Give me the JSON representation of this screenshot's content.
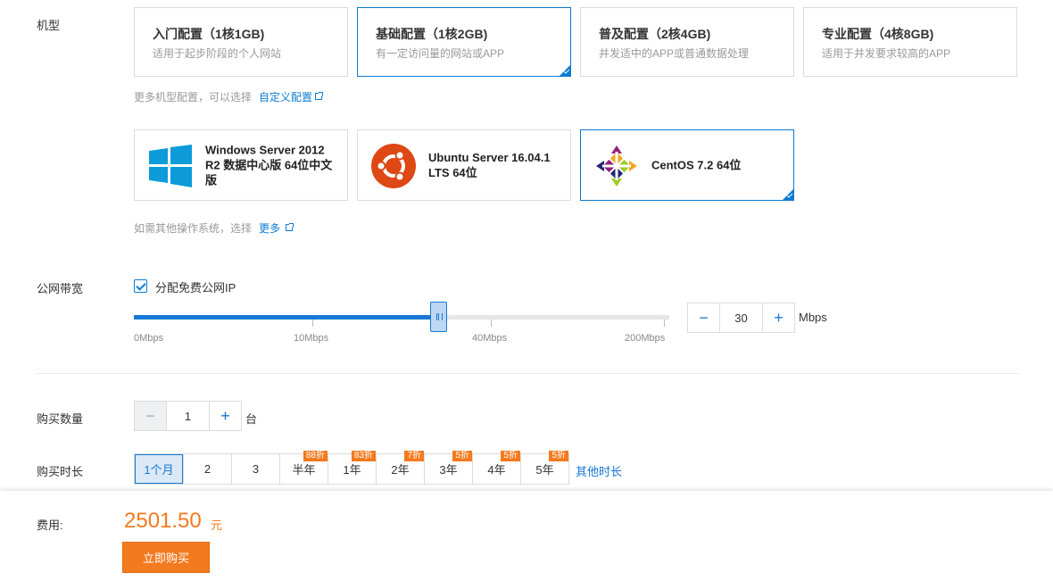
{
  "labels": {
    "model": "机型",
    "bandwidth": "公网带宽",
    "quantity": "购买数量",
    "duration": "购买时长",
    "fee": "费用:"
  },
  "specs": [
    {
      "title": "入门配置（1核1GB)",
      "desc": "适用于起步阶段的个人网站",
      "selected": false
    },
    {
      "title": "基础配置（1核2GB)",
      "desc": "有一定访问量的网站或APP",
      "selected": true
    },
    {
      "title": "普及配置（2核4GB)",
      "desc": "并发适中的APP或普通数据处理",
      "selected": false
    },
    {
      "title": "专业配置（4核8GB)",
      "desc": "适用于并发要求较高的APP",
      "selected": false
    }
  ],
  "spec_hint": {
    "text": "更多机型配置，可以选择",
    "link": "自定义配置"
  },
  "os": [
    {
      "name": "Windows Server 2012 R2 数据中心版 64位中文版",
      "icon": "windows-logo-icon",
      "selected": false
    },
    {
      "name": "Ubuntu Server 16.04.1 LTS 64位",
      "icon": "ubuntu-logo-icon",
      "selected": false
    },
    {
      "name": "CentOS 7.2 64位",
      "icon": "centos-logo-icon",
      "selected": true
    }
  ],
  "os_hint": {
    "text": "如需其他操作系统，选择",
    "link": "更多"
  },
  "bandwidth": {
    "checkbox_label": "分配免费公网IP",
    "checked": true,
    "ticks": [
      "0Mbps",
      "10Mbps",
      "40Mbps",
      "200Mbps"
    ],
    "value": "30",
    "unit": "Mbps",
    "slider_fraction": 0.57
  },
  "quantity": {
    "value": "1",
    "unit": "台"
  },
  "duration": {
    "options": [
      {
        "label": "1个月",
        "badge": "",
        "selected": true
      },
      {
        "label": "2",
        "badge": "",
        "selected": false
      },
      {
        "label": "3",
        "badge": "",
        "selected": false
      },
      {
        "label": "半年",
        "badge": "88折",
        "selected": false
      },
      {
        "label": "1年",
        "badge": "83折",
        "selected": false
      },
      {
        "label": "2年",
        "badge": "7折",
        "selected": false
      },
      {
        "label": "3年",
        "badge": "5折",
        "selected": false
      },
      {
        "label": "4年",
        "badge": "5折",
        "selected": false
      },
      {
        "label": "5年",
        "badge": "5折",
        "selected": false
      }
    ],
    "more": "其他时长"
  },
  "footer": {
    "price": "2501.50",
    "price_unit": "元",
    "buy_label": "立即购买"
  },
  "colors": {
    "accent": "#1778d5",
    "orange": "#f47a1f"
  }
}
